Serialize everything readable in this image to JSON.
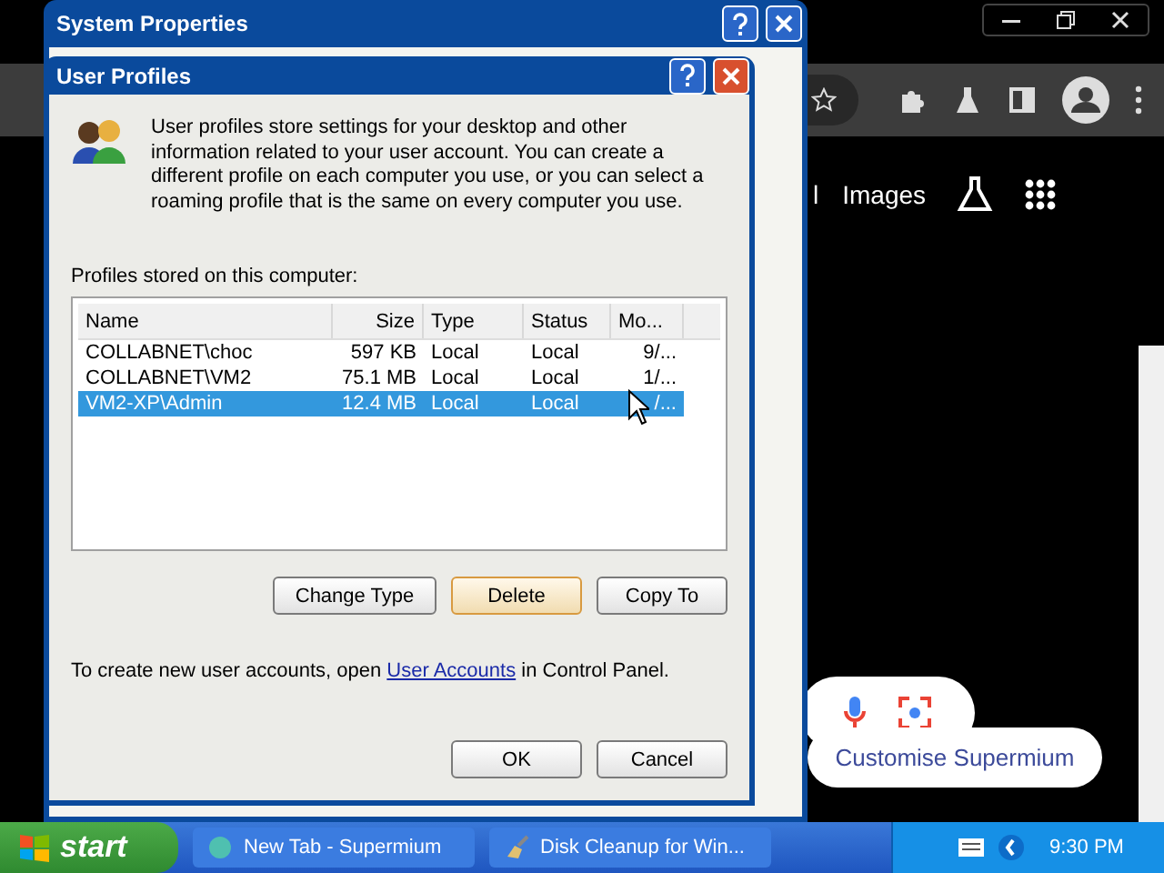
{
  "browser": {
    "nav_links": [
      "l",
      "Images"
    ],
    "customise_chip": "Customise Supermium"
  },
  "system_properties": {
    "title": "System Properties"
  },
  "user_profiles": {
    "title": "User Profiles",
    "description": "User profiles store settings for your desktop and other information related to your user account. You can create a different profile on each computer you use, or you can select a roaming profile that is the same on every computer you use.",
    "profiles_label": "Profiles stored on this computer:",
    "columns": [
      "Name",
      "Size",
      "Type",
      "Status",
      "Mo..."
    ],
    "rows": [
      {
        "cells": [
          "COLLABNET\\choc",
          "597 KB",
          "Local",
          "Local",
          "9/..."
        ],
        "selected": false
      },
      {
        "cells": [
          "COLLABNET\\VM2",
          "75.1 MB",
          "Local",
          "Local",
          "1/..."
        ],
        "selected": false
      },
      {
        "cells": [
          "VM2-XP\\Admin",
          "12.4 MB",
          "Local",
          "Local",
          "/..."
        ],
        "selected": true
      }
    ],
    "profile_buttons": [
      {
        "label": "Change Type",
        "default": false
      },
      {
        "label": "Delete",
        "default": true
      },
      {
        "label": "Copy To",
        "default": false
      }
    ],
    "footer": {
      "before": "To create new user accounts, open",
      "link": "User Accounts",
      "after": "in Control Panel."
    },
    "dialog_buttons": [
      "OK",
      "Cancel"
    ]
  },
  "taskbar": {
    "start": "start",
    "tasks": [
      "New Tab - Supermium",
      "Disk Cleanup for Win..."
    ],
    "clock": "9:30 PM"
  }
}
